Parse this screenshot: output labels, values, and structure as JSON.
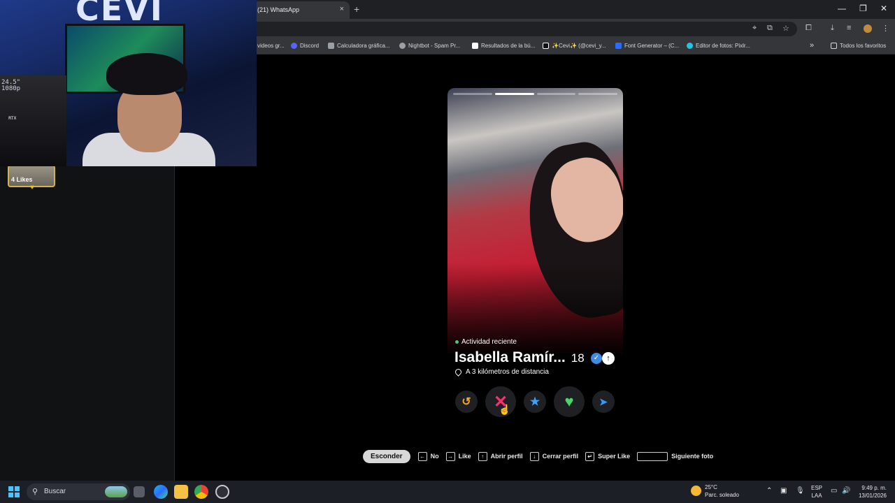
{
  "browser": {
    "tab_title": "(21) WhatsApp",
    "tab_close": "×",
    "new_tab": "+",
    "window_controls": [
      "—",
      "❐",
      "✕"
    ],
    "bookmarks": [
      {
        "label": "videos gr...",
        "color": "#9aa0a6"
      },
      {
        "label": "Discord",
        "color": "#5865f2"
      },
      {
        "label": "Calculadora gráfica...",
        "color": "#9aa0a6"
      },
      {
        "label": "Nightbot - Spam Pr...",
        "color": "#9aa0a6"
      },
      {
        "label": "Resultados de la bú...",
        "color": "#ffffff"
      },
      {
        "label": "✨Cevi✨ (@cevi_y...",
        "color": "#111111"
      },
      {
        "label": "Font Generator – (C...",
        "color": "#2b6cff"
      },
      {
        "label": "Editor de fotos: Pixlr...",
        "color": "#26c3e8"
      }
    ],
    "more_bookmarks": "»",
    "all_favorites": "Todos los favoritos"
  },
  "left_panel": {
    "likes_label": "4 Likes",
    "likes_heart": "♥"
  },
  "webcam": {
    "logo": "CEVI",
    "monitor_text": "24.5\"\n1080p",
    "rtx_label": "RTX"
  },
  "profile": {
    "activity": "Actividad reciente",
    "name": "Isabella Ramír...",
    "age": "18",
    "verified_icon": "✓",
    "info_icon": "↑",
    "distance": "A 3 kilómetros de distancia",
    "photo_count": 4,
    "active_photo": 1
  },
  "actions": {
    "rewind": "↺",
    "nope": "✕",
    "super_like": "★",
    "like": "♥",
    "boost": "➤"
  },
  "hints": {
    "hide_button": "Esconder",
    "items": [
      {
        "key": "←",
        "label": "No"
      },
      {
        "key": "→",
        "label": "Like"
      },
      {
        "key": "↑",
        "label": "Abrir perfil"
      },
      {
        "key": "↓",
        "label": "Cerrar perfil"
      },
      {
        "key": "↵",
        "label": "Super Like"
      },
      {
        "key": "",
        "label": "Siguiente foto"
      }
    ]
  },
  "taskbar": {
    "search_placeholder": "Buscar",
    "weather_temp": "25°C",
    "weather_desc": "Parc. soleado",
    "lang_top": "ESP",
    "lang_bottom": "LAA",
    "time": "9:49 p. m.",
    "date": "13/01/2026"
  },
  "colors": {
    "nope": "#ff2e6e",
    "like": "#4ad66d",
    "super": "#3ea0ff",
    "rewind": "#f5a623",
    "activity_dot": "#36d17a",
    "verified": "#3f8ce0"
  }
}
